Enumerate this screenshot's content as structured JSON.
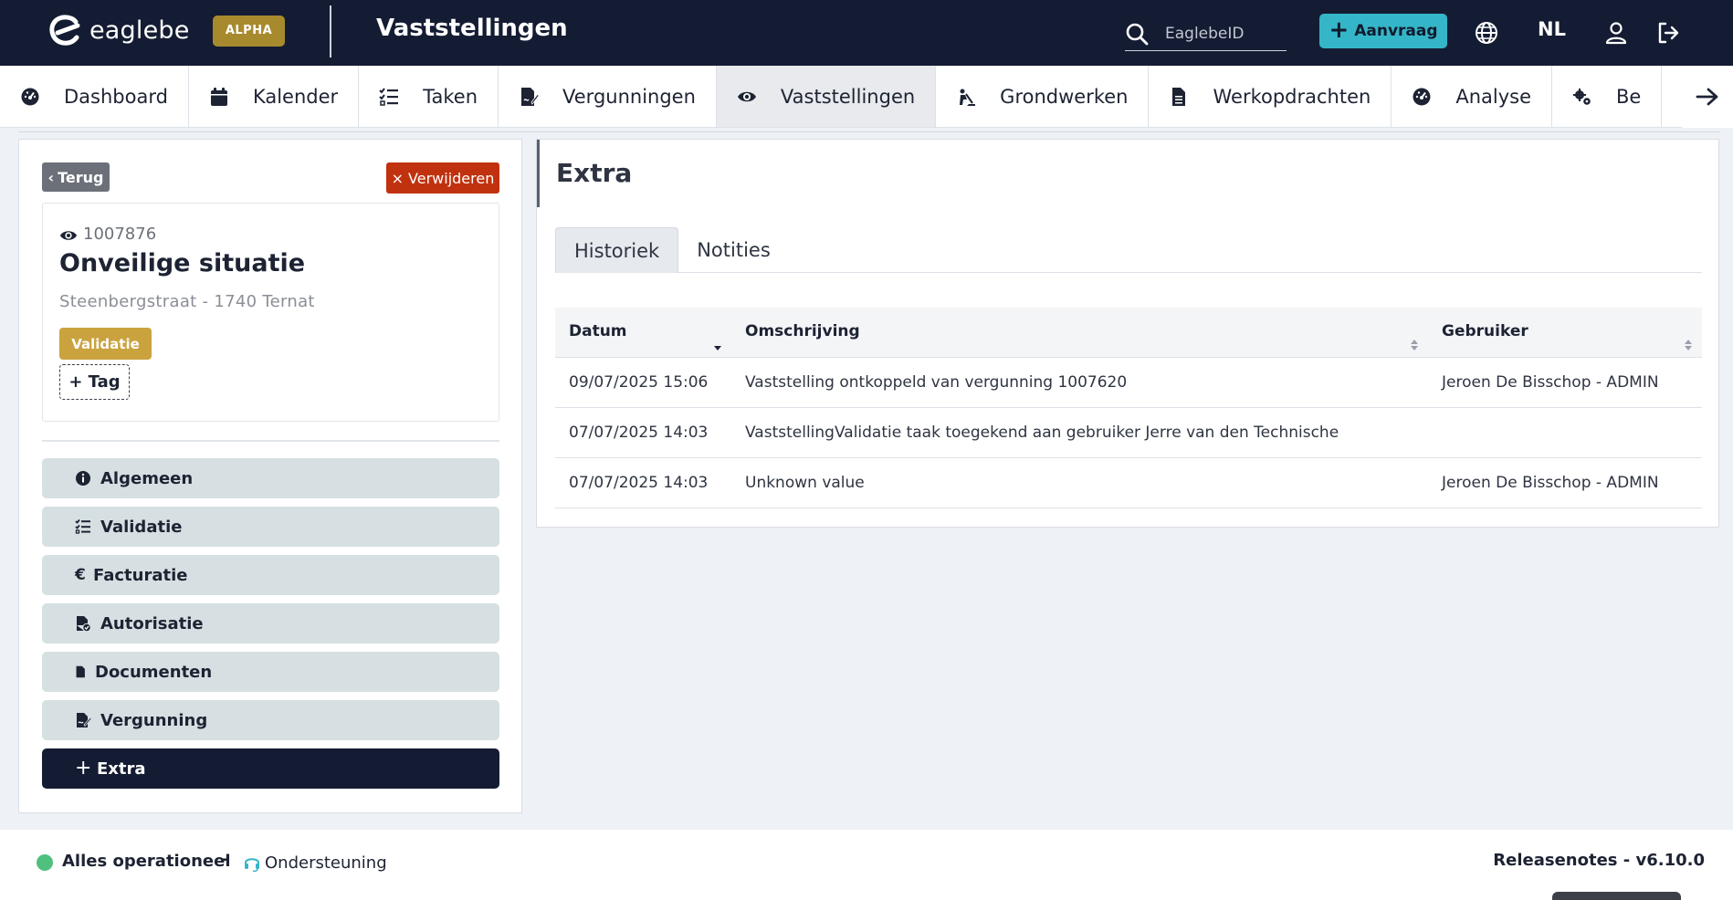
{
  "topbar": {
    "logo_text": "eaglebe",
    "badge": "ALPHA",
    "title": "Vaststellingen",
    "search_placeholder": "EaglebeID",
    "new_request_label": "Aanvraag",
    "language": "NL",
    "icons": [
      "search-icon",
      "globe-icon",
      "user-icon",
      "logout-icon"
    ]
  },
  "nav": {
    "items": [
      {
        "label": "Dashboard",
        "icon": "dashboard-icon"
      },
      {
        "label": "Kalender",
        "icon": "calendar-icon"
      },
      {
        "label": "Taken",
        "icon": "tasks-icon"
      },
      {
        "label": "Vergunningen",
        "icon": "permit-icon"
      },
      {
        "label": "Vaststellingen",
        "icon": "eye-icon",
        "active": true
      },
      {
        "label": "Grondwerken",
        "icon": "digging-icon"
      },
      {
        "label": "Werkopdrachten",
        "icon": "document-icon"
      },
      {
        "label": "Analyse",
        "icon": "gauge-icon"
      },
      {
        "label": "Be",
        "icon": "gears-icon"
      }
    ]
  },
  "detail": {
    "back_label": "Terug",
    "delete_label": "Verwijderen",
    "case_id": "1007876",
    "case_title": "Onveilige situatie",
    "address": "Steenbergstraat - 1740 Ternat",
    "status": "Validatie",
    "tag_label": "+ Tag",
    "menu": [
      {
        "label": "Algemeen",
        "icon": "info-icon"
      },
      {
        "label": "Validatie",
        "icon": "checklist-icon"
      },
      {
        "label": "Facturatie",
        "icon": "euro-icon"
      },
      {
        "label": "Autorisatie",
        "icon": "file-check-icon"
      },
      {
        "label": "Documenten",
        "icon": "file-icon"
      },
      {
        "label": "Vergunning",
        "icon": "file-sign-icon"
      },
      {
        "label": "Extra",
        "icon": "plus-icon",
        "active": true
      }
    ]
  },
  "extra": {
    "title": "Extra",
    "tabs": [
      {
        "label": "Historiek",
        "active": true
      },
      {
        "label": "Notities"
      }
    ],
    "columns": [
      "Datum",
      "Omschrijving",
      "Gebruiker"
    ],
    "rows": [
      {
        "date": "09/07/2025 15:06",
        "description": "Vaststelling ontkoppeld van vergunning 1007620",
        "user": "Jeroen De Bisschop - ADMIN"
      },
      {
        "date": "07/07/2025 14:03",
        "description": "VaststellingValidatie taak toegekend aan gebruiker Jerre van den Technische",
        "user": ""
      },
      {
        "date": "07/07/2025 14:03",
        "description": "Unknown value",
        "user": "Jeroen De Bisschop - ADMIN"
      }
    ]
  },
  "footer": {
    "status": "Alles operationeel",
    "separator": "-",
    "support": "Ondersteuning",
    "release": "Releasenotes - v6.10.0"
  },
  "colors": {
    "topbar": "#141c33",
    "accent": "#34b6c8",
    "alpha_badge": "#a88a2e",
    "delete": "#c0320f",
    "status_badge": "#caa23e",
    "menu_item": "#d6e0e2",
    "status_ok": "#4fc07d"
  }
}
